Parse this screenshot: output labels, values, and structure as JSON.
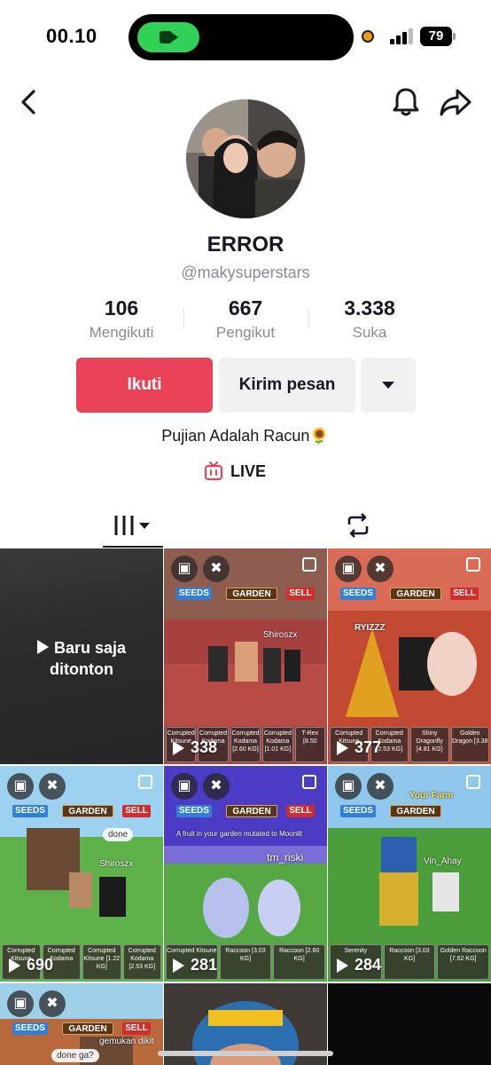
{
  "status_bar": {
    "time": "00.10",
    "battery": "79"
  },
  "profile": {
    "display_name": "ERROR",
    "username": "@makysuperstars",
    "following_count": "106",
    "following_label": "Mengikuti",
    "followers_count": "667",
    "followers_label": "Pengikut",
    "likes_count": "3.338",
    "likes_label": "Suka",
    "bio": "Pujian Adalah Racun🌻",
    "live_label": "LIVE"
  },
  "actions": {
    "follow_label": "Ikuti",
    "message_label": "Kirim pesan"
  },
  "tabs": [
    {
      "icon": "grid-icon"
    },
    {
      "icon": "repost-icon"
    }
  ],
  "grid": {
    "watched_line1": "Baru saja",
    "watched_line2": "ditonton",
    "videos": [
      {
        "views": "338",
        "seeds": "SEEDS",
        "garden": "GARDEN",
        "sell": "SELL",
        "caption": "Shiroszx",
        "inv": [
          "Corrupted Kitsune",
          "Corrupted Kodama",
          "Corrupted Kodama [2.60 KG]",
          "Corrupted Kodama [1.01 KG]",
          "T-Rex [8.50"
        ]
      },
      {
        "views": "377",
        "seeds": "SEEDS",
        "garden": "GARDEN",
        "sell": "SELL",
        "caption": "RYIZZZ",
        "inv": [
          "Corrupted Kitsune",
          "Corrupted Kodama [2.53 KG]",
          "Shiny Dragonfly [4.81 KG]",
          "Golden Dragon [3.38"
        ]
      },
      {
        "views": "690",
        "seeds": "SEEDS",
        "garden": "GARDEN",
        "sell": "SELL",
        "caption": "Shiroszx",
        "bubble": "done",
        "inv": [
          "Corrupted Kitsune",
          "Corrupted Kodama",
          "Corrupted Kitsune [1.22 KG]",
          "Corrupted Kodama [2.53 KG]"
        ]
      },
      {
        "views": "281",
        "seeds": "SEEDS",
        "garden": "GARDEN",
        "sell": "SELL",
        "caption": "tm_riski",
        "notice": "A fruit in your garden mutated to Moonlit",
        "inv": [
          "Corrupted Kitsune",
          "Raccoon [3.03 KG]",
          "Raccoon [2.60 KG]"
        ]
      },
      {
        "views": "284",
        "seeds": "SEEDS",
        "garden": "GARDEN",
        "sell": "SELL",
        "caption": "Vin_Ahay",
        "farm": "Your Farm",
        "inv": [
          "Serenity",
          "Raccoon [3.03 KG]",
          "Golden Raccoon [7.62 KG]"
        ]
      },
      {
        "seeds": "SEEDS",
        "garden": "GARDEN",
        "sell": "SELL",
        "bubble": "done ga?",
        "caption2": "gemukan dikit"
      }
    ]
  },
  "colors": {
    "accent": "#ea4359",
    "text": "#161823",
    "muted": "#8a8b91",
    "button_gray": "#f1f1f2"
  }
}
